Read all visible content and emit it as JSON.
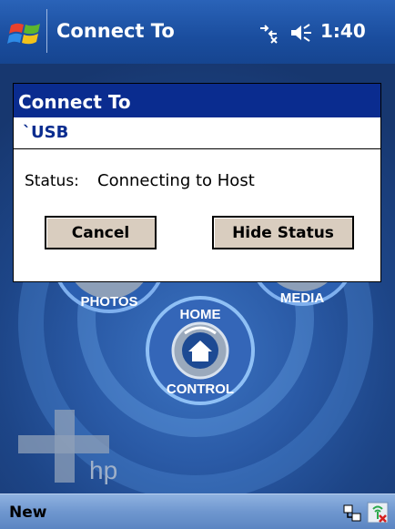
{
  "titlebar": {
    "title": "Connect To",
    "clock": "1:40"
  },
  "background": {
    "app_labels": [
      "PHOTOS",
      "MEDIA",
      "HOME",
      "CONTROL"
    ],
    "brand": "hp"
  },
  "dialog": {
    "title": "Connect To",
    "connection": "`USB",
    "status_label": "Status:",
    "status_value": "Connecting to Host",
    "cancel_label": "Cancel",
    "hide_label": "Hide Status"
  },
  "bottombar": {
    "softkey_left": "New"
  },
  "colors": {
    "titlebar": "#1a4d9e",
    "dialog_title": "#0a2c8f",
    "button_face": "#d9cdbf"
  }
}
